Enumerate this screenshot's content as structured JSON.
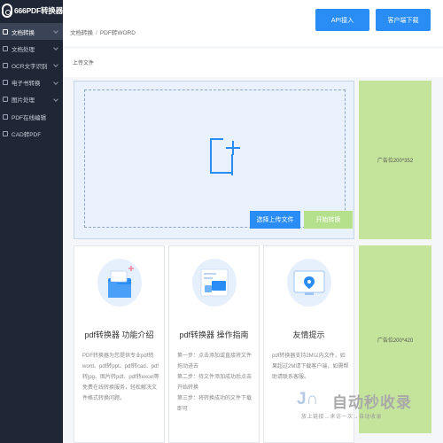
{
  "app": {
    "logo_text": "666PDF转换器"
  },
  "sidebar": {
    "items": [
      {
        "label": "文档转换",
        "active": true
      },
      {
        "label": "文档处理"
      },
      {
        "label": "OCR文字识别"
      },
      {
        "label": "电子书转换"
      },
      {
        "label": "图片处理"
      },
      {
        "label": "PDF在线编辑"
      },
      {
        "label": "CAD转PDF"
      }
    ]
  },
  "header": {
    "api_button": "API接入",
    "client_button": "客户端下载",
    "breadcrumb": [
      "文档转换",
      "PDF转WORD"
    ]
  },
  "upload": {
    "section_label": "上传文件",
    "select_button": "选择上传文件",
    "start_button": "开始转换"
  },
  "ads": {
    "ad1": "广告位200*352",
    "ad2": "广告位200*420"
  },
  "cards": [
    {
      "title": "pdf转换器 功能介绍",
      "body": "PDF转换器为您提供专业pdf转word、pdf转ppt、pdf转cad、pdf转jpg、图片转pdf、pdf转excel等免费在线转换服务，轻松解决文件格式转换问题。"
    },
    {
      "title": "pdf转换器 操作指南",
      "body_lines": [
        "第一步：点击添加或直接将文件拖动进去",
        "第二步：待文件添加成功后点击开始转换",
        "第三步：将转换成功的文件下载即可"
      ]
    },
    {
      "title": "友情提示",
      "body": "pdf转换器支持2M以内文件，如果超过2M请下载客户端，如需帮助请联系客服。"
    }
  ],
  "watermark": {
    "brand": "自动秒收录",
    "tagline": "放上链接→来访一次→自动收录"
  },
  "colors": {
    "primary": "#2a8df5",
    "sidebar": "#1f2736",
    "ad": "#c4e49c",
    "start_button": "#b5e08c"
  }
}
